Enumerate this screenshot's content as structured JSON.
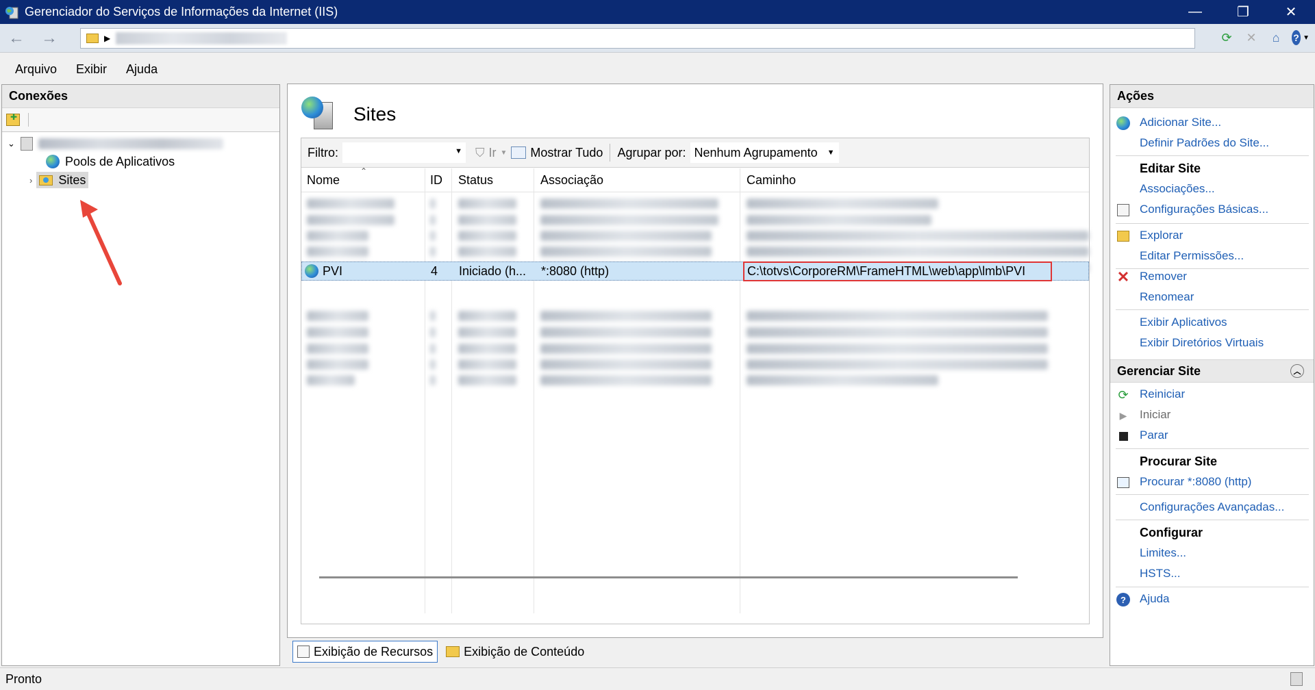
{
  "window": {
    "title": "Gerenciador do Serviços de Informações da Internet (IIS)",
    "minimize": "—",
    "restore": "❐",
    "close": "✕"
  },
  "menu": [
    "Arquivo",
    "Exibir",
    "Ajuda"
  ],
  "connections": {
    "header": "Conexões",
    "tree": {
      "pools": "Pools de Aplicativos",
      "sites": "Sites"
    }
  },
  "main": {
    "title": "Sites",
    "filter_label": "Filtro:",
    "go_label": "Ir",
    "show_all": "Mostrar Tudo",
    "group_by_label": "Agrupar por:",
    "group_by_value": "Nenhum Agrupamento",
    "columns": [
      "Nome",
      "ID",
      "Status",
      "Associação",
      "Caminho"
    ],
    "selected_row": {
      "name": "PVI",
      "id": "4",
      "status": "Iniciado (h...",
      "binding": "*:8080 (http)",
      "path": "C:\\totvs\\CorporeRM\\FrameHTML\\web\\app\\lmb\\PVI"
    },
    "view_tabs": [
      "Exibição de Recursos",
      "Exibição de Conteúdo"
    ]
  },
  "actions": {
    "header": "Ações",
    "add_site": "Adicionar Site...",
    "site_defaults": "Definir Padrões do Site...",
    "edit_site": "Editar Site",
    "bindings": "Associações...",
    "basic_settings": "Configurações Básicas...",
    "explore": "Explorar",
    "edit_permissions": "Editar Permissões...",
    "remove": "Remover",
    "rename": "Renomear",
    "view_apps": "Exibir Aplicativos",
    "view_vdirs": "Exibir Diretórios Virtuais",
    "manage_site": "Gerenciar Site",
    "restart": "Reiniciar",
    "start": "Iniciar",
    "stop": "Parar",
    "browse_site": "Procurar Site",
    "browse_8080": "Procurar *:8080 (http)",
    "advanced": "Configurações Avançadas...",
    "configure": "Configurar",
    "limits": "Limites...",
    "hsts": "HSTS...",
    "help": "Ajuda"
  },
  "status": {
    "text": "Pronto"
  },
  "colors": {
    "titlebar": "#0b2a73",
    "link": "#1f5fb5",
    "selection": "#cce4f7",
    "highlight_box": "#e03535",
    "annotation_arrow": "#e8463a"
  }
}
